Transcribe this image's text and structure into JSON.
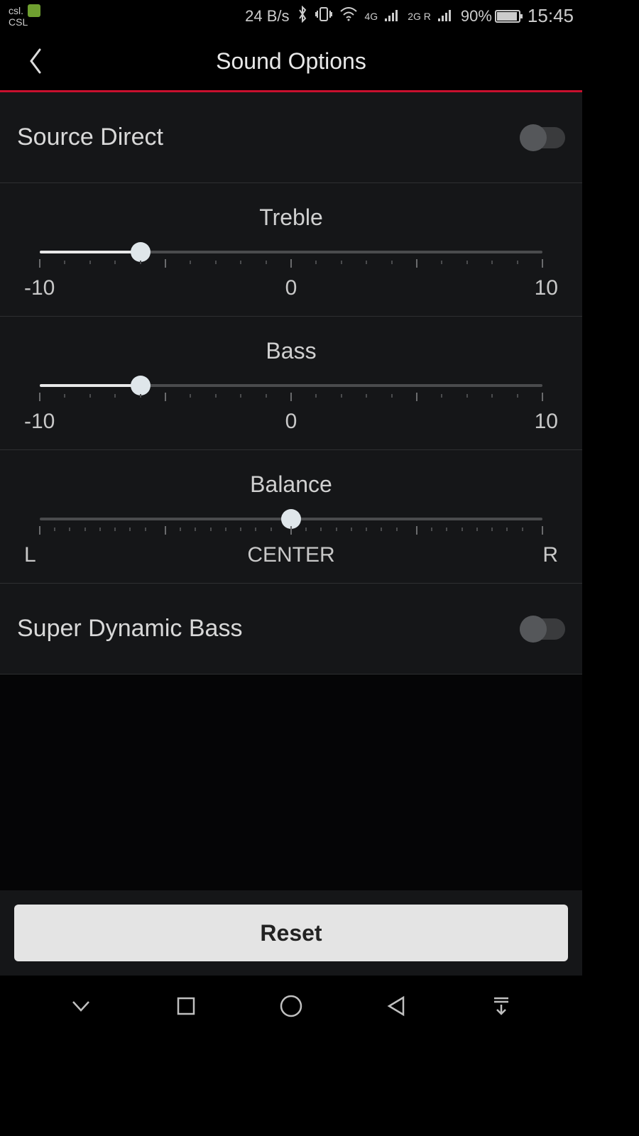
{
  "status": {
    "carrier_top": "csl.",
    "carrier_bottom": "CSL",
    "net_speed": "24 B/s",
    "battery_pct": "90%",
    "time": "15:45",
    "sig1_label": "4G",
    "sig2_label": "2G R"
  },
  "header": {
    "title": "Sound Options"
  },
  "settings": {
    "source_direct": {
      "label": "Source Direct",
      "on": false
    },
    "treble": {
      "label": "Treble",
      "min_label": "-10",
      "center_label": "0",
      "max_label": "10",
      "value_pct": 20,
      "ticks": {
        "major": [
          0,
          25,
          50,
          75,
          100
        ],
        "minor": [
          5,
          10,
          15,
          20,
          30,
          35,
          40,
          45,
          55,
          60,
          65,
          70,
          80,
          85,
          90,
          95
        ]
      }
    },
    "bass": {
      "label": "Bass",
      "min_label": "-10",
      "center_label": "0",
      "max_label": "10",
      "value_pct": 20,
      "ticks": {
        "major": [
          0,
          25,
          50,
          75,
          100
        ],
        "minor": [
          5,
          10,
          15,
          20,
          30,
          35,
          40,
          45,
          55,
          60,
          65,
          70,
          80,
          85,
          90,
          95
        ]
      }
    },
    "balance": {
      "label": "Balance",
      "min_label": "L",
      "center_label": "CENTER",
      "max_label": "R",
      "value_pct": 50,
      "ticks": {
        "major": [
          0,
          25,
          50,
          75,
          100
        ],
        "minor": [
          3,
          6,
          9,
          12,
          15,
          18,
          21,
          28,
          31,
          34,
          37,
          40,
          43,
          46,
          53,
          56,
          59,
          62,
          65,
          68,
          71,
          78,
          81,
          84,
          87,
          90,
          93,
          96
        ]
      }
    },
    "super_dynamic_bass": {
      "label": "Super Dynamic Bass",
      "on": false
    }
  },
  "footer": {
    "reset": "Reset"
  }
}
